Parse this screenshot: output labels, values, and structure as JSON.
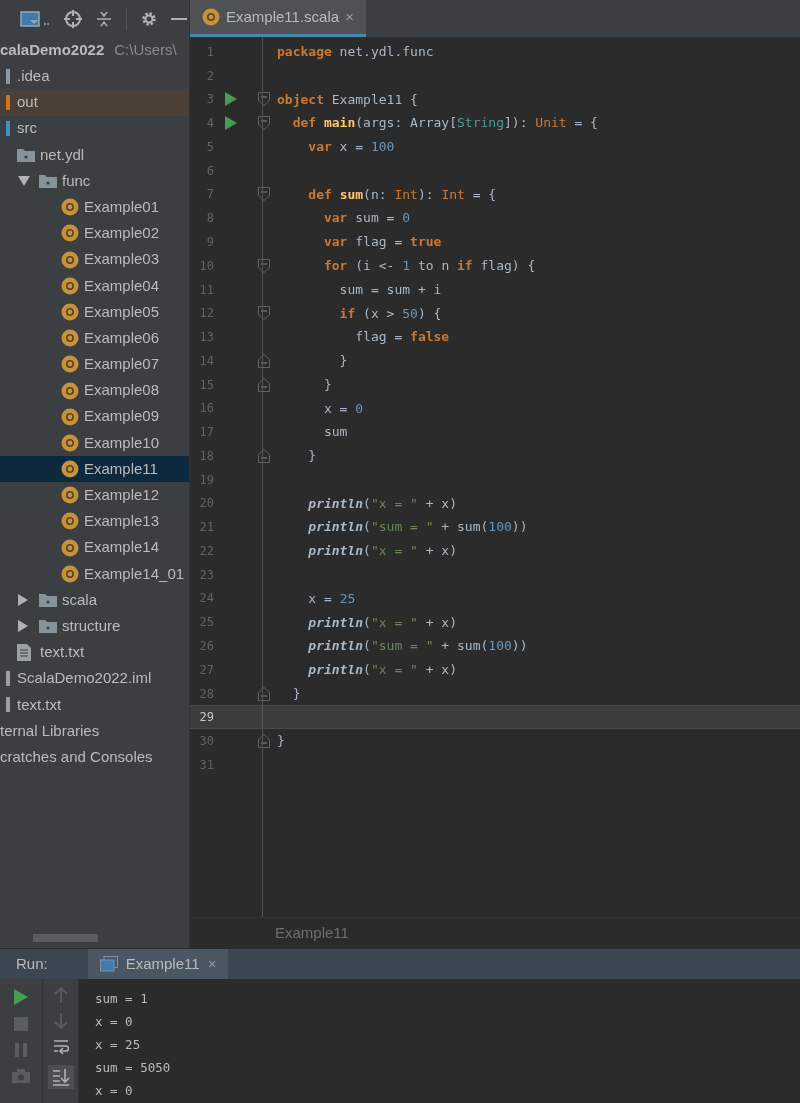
{
  "project_panel": {
    "tree": [
      {
        "label": "calaDemo2022",
        "path": "C:\\Users\\",
        "selected": false,
        "excluded": false,
        "children": [
          {
            "label": ".idea",
            "kind": "cut-folder",
            "color": "#8c9aa6",
            "selected": false,
            "excluded": false
          },
          {
            "label": "out",
            "kind": "cut-folder",
            "color": "#d2731f",
            "selected": false,
            "excluded": true
          },
          {
            "label": "src",
            "kind": "cut-folder",
            "color": "#3f8fc9",
            "selected": false,
            "excluded": false,
            "children": [
              {
                "label": "net.ydl",
                "kind": "package",
                "selected": false,
                "excluded": false,
                "children": [
                  {
                    "label": "func",
                    "kind": "package",
                    "expanded": true,
                    "selected": false,
                    "excluded": false,
                    "children": [
                      {
                        "label": "Example01",
                        "kind": "object",
                        "selected": false,
                        "excluded": false
                      },
                      {
                        "label": "Example02",
                        "kind": "object",
                        "selected": false,
                        "excluded": false
                      },
                      {
                        "label": "Example03",
                        "kind": "object",
                        "selected": false,
                        "excluded": false
                      },
                      {
                        "label": "Example04",
                        "kind": "object",
                        "selected": false,
                        "excluded": false
                      },
                      {
                        "label": "Example05",
                        "kind": "object",
                        "selected": false,
                        "excluded": false
                      },
                      {
                        "label": "Example06",
                        "kind": "object",
                        "selected": false,
                        "excluded": false
                      },
                      {
                        "label": "Example07",
                        "kind": "object",
                        "selected": false,
                        "excluded": false
                      },
                      {
                        "label": "Example08",
                        "kind": "object",
                        "selected": false,
                        "excluded": false
                      },
                      {
                        "label": "Example09",
                        "kind": "object",
                        "selected": false,
                        "excluded": false
                      },
                      {
                        "label": "Example10",
                        "kind": "object",
                        "selected": false,
                        "excluded": false
                      },
                      {
                        "label": "Example11",
                        "kind": "object",
                        "selected": true,
                        "excluded": false
                      },
                      {
                        "label": "Example12",
                        "kind": "object",
                        "selected": false,
                        "excluded": false
                      },
                      {
                        "label": "Example13",
                        "kind": "object",
                        "selected": false,
                        "excluded": false
                      },
                      {
                        "label": "Example14",
                        "kind": "object",
                        "selected": false,
                        "excluded": false
                      },
                      {
                        "label": "Example14_01",
                        "kind": "object",
                        "selected": false,
                        "excluded": false
                      }
                    ]
                  },
                  {
                    "label": "scala",
                    "kind": "package",
                    "expanded": false,
                    "selected": false,
                    "excluded": false
                  },
                  {
                    "label": "structure",
                    "kind": "package",
                    "expanded": false,
                    "selected": false,
                    "excluded": false
                  }
                ]
              },
              {
                "label": "text.txt",
                "kind": "text-file",
                "selected": false,
                "excluded": false
              }
            ]
          },
          {
            "label": "ScalaDemo2022.iml",
            "kind": "cut-folder",
            "color": "#9aa0a6",
            "selected": false,
            "excluded": false
          },
          {
            "label": "text.txt",
            "kind": "cut-folder",
            "color": "#9aa0a6",
            "selected": false,
            "excluded": false
          }
        ]
      },
      {
        "label": "ternal Libraries",
        "selected": false,
        "excluded": false
      },
      {
        "label": "cratches and Consoles",
        "selected": false,
        "excluded": false
      }
    ]
  },
  "editor": {
    "tabs": [
      {
        "label": "Example11.scala",
        "close": "×",
        "selected": true
      }
    ],
    "lines": [
      {
        "number": "1",
        "current": false,
        "tokens": [
          {
            "kind": "kw",
            "text": "package"
          },
          {
            "kind": "plain",
            "text": " net.ydl.func"
          }
        ]
      },
      {
        "number": "2",
        "current": false
      },
      {
        "number": "3",
        "current": false,
        "gutter": [
          {
            "kind": "run"
          },
          {
            "kind": "fold-start"
          }
        ],
        "tokens": [
          {
            "kind": "kw",
            "text": "object"
          },
          {
            "kind": "plain",
            "text": " Example11 {"
          }
        ]
      },
      {
        "number": "4",
        "current": false,
        "gutter": [
          {
            "kind": "run"
          },
          {
            "kind": "fold-start"
          }
        ],
        "tokens": [
          {
            "kind": "kw",
            "text": "  def "
          },
          {
            "kind": "def",
            "text": "main"
          },
          {
            "kind": "plain",
            "text": "(args: Array["
          },
          {
            "kind": "type",
            "text": "String"
          },
          {
            "kind": "plain",
            "text": "]): "
          },
          {
            "kind": "ktype",
            "text": "Unit"
          },
          {
            "kind": "plain",
            "text": " = {"
          }
        ]
      },
      {
        "number": "5",
        "current": false,
        "tokens": [
          {
            "kind": "kw",
            "text": "    var"
          },
          {
            "kind": "plain",
            "text": " x = "
          },
          {
            "kind": "num",
            "text": "100"
          }
        ]
      },
      {
        "number": "6",
        "current": false
      },
      {
        "number": "7",
        "current": false,
        "gutter": [
          {
            "kind": "fold-start"
          }
        ],
        "tokens": [
          {
            "kind": "kw",
            "text": "    def "
          },
          {
            "kind": "def",
            "text": "sum"
          },
          {
            "kind": "plain",
            "text": "(n: "
          },
          {
            "kind": "ktype",
            "text": "Int"
          },
          {
            "kind": "plain",
            "text": "): "
          },
          {
            "kind": "ktype",
            "text": "Int"
          },
          {
            "kind": "plain",
            "text": " = {"
          }
        ]
      },
      {
        "number": "8",
        "current": false,
        "tokens": [
          {
            "kind": "kw",
            "text": "      var"
          },
          {
            "kind": "plain",
            "text": " sum = "
          },
          {
            "kind": "num",
            "text": "0"
          }
        ]
      },
      {
        "number": "9",
        "current": false,
        "tokens": [
          {
            "kind": "kw",
            "text": "      var"
          },
          {
            "kind": "plain",
            "text": " flag = "
          },
          {
            "kind": "kw",
            "text": "true"
          }
        ]
      },
      {
        "number": "10",
        "current": false,
        "gutter": [
          {
            "kind": "fold-start"
          }
        ],
        "tokens": [
          {
            "kind": "kw",
            "text": "      for"
          },
          {
            "kind": "plain",
            "text": " (i <- "
          },
          {
            "kind": "num",
            "text": "1"
          },
          {
            "kind": "plain",
            "text": " to n "
          },
          {
            "kind": "kw",
            "text": "if"
          },
          {
            "kind": "plain",
            "text": " flag) {"
          }
        ]
      },
      {
        "number": "11",
        "current": false,
        "tokens": [
          {
            "kind": "plain",
            "text": "        sum = sum + i"
          }
        ]
      },
      {
        "number": "12",
        "current": false,
        "gutter": [
          {
            "kind": "fold-start"
          }
        ],
        "tokens": [
          {
            "kind": "kw",
            "text": "        if"
          },
          {
            "kind": "plain",
            "text": " (x > "
          },
          {
            "kind": "num",
            "text": "50"
          },
          {
            "kind": "plain",
            "text": ") {"
          }
        ]
      },
      {
        "number": "13",
        "current": false,
        "tokens": [
          {
            "kind": "plain",
            "text": "          flag = "
          },
          {
            "kind": "kw",
            "text": "false"
          }
        ]
      },
      {
        "number": "14",
        "current": false,
        "gutter": [
          {
            "kind": "fold-end"
          }
        ],
        "tokens": [
          {
            "kind": "plain",
            "text": "        }"
          }
        ]
      },
      {
        "number": "15",
        "current": false,
        "gutter": [
          {
            "kind": "fold-end"
          }
        ],
        "tokens": [
          {
            "kind": "plain",
            "text": "      }"
          }
        ]
      },
      {
        "number": "16",
        "current": false,
        "tokens": [
          {
            "kind": "plain",
            "text": "      x = "
          },
          {
            "kind": "num",
            "text": "0"
          }
        ]
      },
      {
        "number": "17",
        "current": false,
        "tokens": [
          {
            "kind": "plain",
            "text": "      sum"
          }
        ]
      },
      {
        "number": "18",
        "current": false,
        "gutter": [
          {
            "kind": "fold-end"
          }
        ],
        "tokens": [
          {
            "kind": "plain",
            "text": "    }"
          }
        ]
      },
      {
        "number": "19",
        "current": false
      },
      {
        "number": "20",
        "current": false,
        "tokens": [
          {
            "kind": "call",
            "text": "    println"
          },
          {
            "kind": "plain",
            "text": "("
          },
          {
            "kind": "str",
            "text": "\"x = \""
          },
          {
            "kind": "plain",
            "text": " + x)"
          }
        ]
      },
      {
        "number": "21",
        "current": false,
        "tokens": [
          {
            "kind": "call",
            "text": "    println"
          },
          {
            "kind": "plain",
            "text": "("
          },
          {
            "kind": "str",
            "text": "\"sum = \""
          },
          {
            "kind": "plain",
            "text": " + sum("
          },
          {
            "kind": "num",
            "text": "100"
          },
          {
            "kind": "plain",
            "text": "))"
          }
        ]
      },
      {
        "number": "22",
        "current": false,
        "tokens": [
          {
            "kind": "call",
            "text": "    println"
          },
          {
            "kind": "plain",
            "text": "("
          },
          {
            "kind": "str",
            "text": "\"x = \""
          },
          {
            "kind": "plain",
            "text": " + x)"
          }
        ]
      },
      {
        "number": "23",
        "current": false
      },
      {
        "number": "24",
        "current": false,
        "tokens": [
          {
            "kind": "plain",
            "text": "    x = "
          },
          {
            "kind": "num",
            "text": "25"
          }
        ]
      },
      {
        "number": "25",
        "current": false,
        "tokens": [
          {
            "kind": "call",
            "text": "    println"
          },
          {
            "kind": "plain",
            "text": "("
          },
          {
            "kind": "str",
            "text": "\"x = \""
          },
          {
            "kind": "plain",
            "text": " + x)"
          }
        ]
      },
      {
        "number": "26",
        "current": false,
        "tokens": [
          {
            "kind": "call",
            "text": "    println"
          },
          {
            "kind": "plain",
            "text": "("
          },
          {
            "kind": "str",
            "text": "\"sum = \""
          },
          {
            "kind": "plain",
            "text": " + sum("
          },
          {
            "kind": "num",
            "text": "100"
          },
          {
            "kind": "plain",
            "text": "))"
          }
        ]
      },
      {
        "number": "27",
        "current": false,
        "tokens": [
          {
            "kind": "call",
            "text": "    println"
          },
          {
            "kind": "plain",
            "text": "("
          },
          {
            "kind": "str",
            "text": "\"x = \""
          },
          {
            "kind": "plain",
            "text": " + x)"
          }
        ]
      },
      {
        "number": "28",
        "current": false,
        "gutter": [
          {
            "kind": "fold-end"
          }
        ],
        "tokens": [
          {
            "kind": "plain",
            "text": "  }"
          }
        ]
      },
      {
        "number": "29",
        "current": true
      },
      {
        "number": "30",
        "current": false,
        "gutter": [
          {
            "kind": "fold-end"
          }
        ],
        "tokens": [
          {
            "kind": "plain",
            "text": "}"
          }
        ]
      },
      {
        "number": "31",
        "current": false
      }
    ],
    "breadcrumb": "Example11"
  },
  "run_panel": {
    "label": "Run:",
    "tabs": [
      {
        "label": "Example11",
        "close": "×",
        "selected": true
      }
    ],
    "output": [
      "sum = 1",
      "x = 0",
      "x = 25",
      "sum = 5050",
      "x = 0"
    ]
  }
}
